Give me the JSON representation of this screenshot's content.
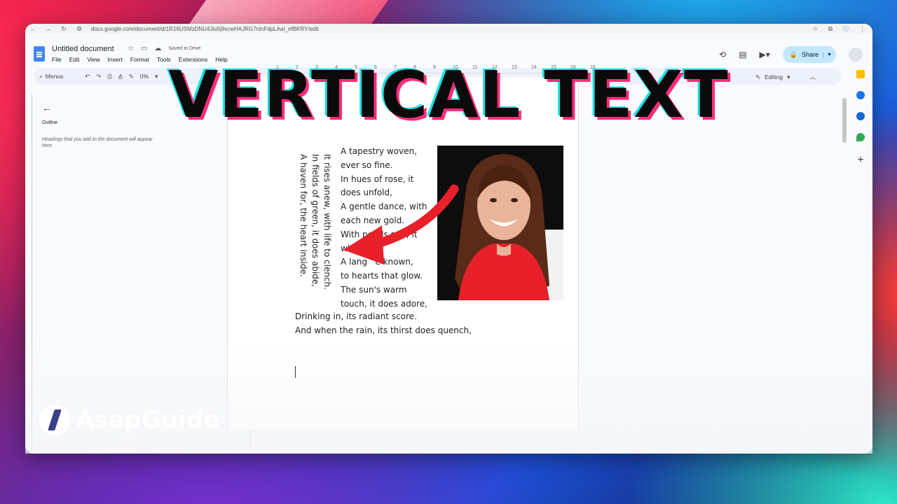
{
  "browser": {
    "url": "docs.google.com/document/d/1R16USMzDNU4Jiu5j9vcwHAJRG7nlnFdpLAaI_efBKRY/edit"
  },
  "docs": {
    "title": "Untitled document",
    "saved_status": "Saved to Drive",
    "menu": [
      "File",
      "Edit",
      "View",
      "Insert",
      "Format",
      "Tools",
      "Extensions",
      "Help"
    ],
    "share_label": "Share",
    "toolbar": {
      "menus_label": "Menus",
      "zoom_partial": "0%",
      "editing_label": "Editing"
    },
    "ruler_ticks": [
      "1",
      "2",
      "3",
      "4",
      "5",
      "6",
      "7",
      "8",
      "9",
      "10",
      "11",
      "12",
      "13",
      "14",
      "15",
      "16",
      "18"
    ]
  },
  "outline": {
    "title": "Outline",
    "hint": "Headings that you add to the document will appear here."
  },
  "document": {
    "vertical_lines": [
      "It rises anew, with life to clench.",
      "In fields of green, it does abide,",
      "A haven for, the heart inside."
    ],
    "poem_lines": [
      "A tapestry woven,",
      "ever so fine.",
      "In hues of rose, it",
      "does unfold,",
      "A gentle dance, with",
      "each new gold.",
      "With petals soft, it",
      "wh",
      "A lang   e known,",
      "to hearts that glow.",
      "The sun's warm",
      "touch, it does adore,"
    ],
    "tail_lines": [
      "Drinking in, its radiant score.",
      "And when the rain, its thirst does quench,"
    ]
  },
  "overlay": {
    "headline": "VERTICAL TEXT",
    "brand": "AsapGuide"
  },
  "colors": {
    "accent_blue": "#4285f4",
    "share_bg": "#c2e7ff",
    "arrow_red": "#e8202a",
    "headline_shadow_pink": "#ff2d7a",
    "headline_shadow_cyan": "#1be0e6"
  }
}
